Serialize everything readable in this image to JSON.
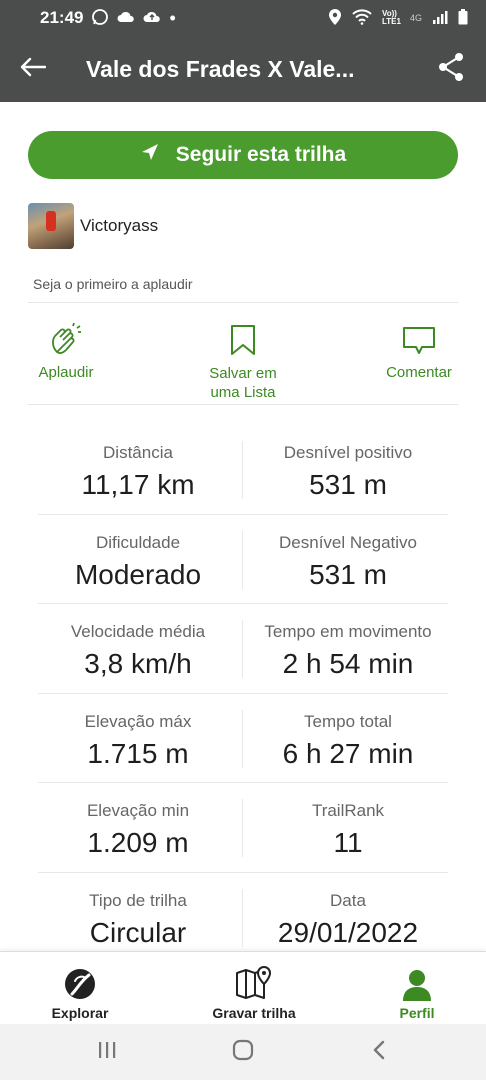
{
  "status_bar": {
    "time": "21:49",
    "network": "4G",
    "volte": "Vo)) LTE1"
  },
  "app_bar": {
    "title": "Vale dos Frades X Vale..."
  },
  "follow_button": {
    "label": "Seguir esta trilha"
  },
  "author": {
    "name": "Victoryass"
  },
  "applause_prompt": "Seja o primeiro a aplaudir",
  "actions": [
    {
      "label": "Aplaudir",
      "icon": "clap-icon"
    },
    {
      "label": "Salvar em uma Lista",
      "icon": "bookmark-icon"
    },
    {
      "label": "Comentar",
      "icon": "comment-icon"
    }
  ],
  "stats": [
    {
      "left": {
        "label": "Distância",
        "value": "11,17 km"
      },
      "right": {
        "label": "Desnível positivo",
        "value": "531 m"
      }
    },
    {
      "left": {
        "label": "Dificuldade",
        "value": "Moderado"
      },
      "right": {
        "label": "Desnível Negativo",
        "value": "531 m"
      }
    },
    {
      "left": {
        "label": "Velocidade média",
        "value": "3,8 km/h"
      },
      "right": {
        "label": "Tempo em movimento",
        "value": "2 h 54 min"
      }
    },
    {
      "left": {
        "label": "Elevação máx",
        "value": "1.715 m"
      },
      "right": {
        "label": "Tempo total",
        "value": "6 h 27 min"
      }
    },
    {
      "left": {
        "label": "Elevação min",
        "value": "1.209 m"
      },
      "right": {
        "label": "TrailRank",
        "value": "11"
      }
    },
    {
      "left": {
        "label": "Tipo de trilha",
        "value": "Circular"
      },
      "right": {
        "label": "Data",
        "value": "29/01/2022"
      }
    }
  ],
  "bottom_nav": [
    {
      "label": "Explorar",
      "icon": "explore-icon",
      "active": false
    },
    {
      "label": "Gravar trilha",
      "icon": "map-record-icon",
      "active": false
    },
    {
      "label": "Perfil",
      "icon": "profile-icon",
      "active": true
    }
  ],
  "colors": {
    "brand_green": "#4a9c2e",
    "action_green": "#3d8a22",
    "app_bar": "#4a4d4b"
  }
}
